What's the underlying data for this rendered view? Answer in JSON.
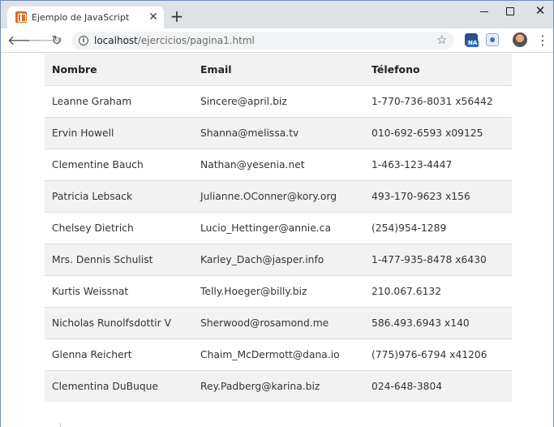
{
  "browser": {
    "tab_title": "Ejemplo de JavaScript",
    "tab_close": "✕",
    "new_tab": "+",
    "url_host": "localhost",
    "url_path": "/ejercicios/pagina1.html",
    "extension_badge": "NA",
    "icons": {
      "favicon": "xampp-icon",
      "back": "arrow-left-icon",
      "forward": "arrow-right-icon",
      "reload": "reload-icon",
      "info": "info-icon",
      "bookmark": "star-icon",
      "menu": "more-vertical-icon"
    }
  },
  "table": {
    "headers": [
      "Nombre",
      "Email",
      "Télefono"
    ],
    "rows": [
      [
        "Leanne Graham",
        "Sincere@april.biz",
        "1-770-736-8031 x56442"
      ],
      [
        "Ervin Howell",
        "Shanna@melissa.tv",
        "010-692-6593 x09125"
      ],
      [
        "Clementine Bauch",
        "Nathan@yesenia.net",
        "1-463-123-4447"
      ],
      [
        "Patricia Lebsack",
        "Julianne.OConner@kory.org",
        "493-170-9623 x156"
      ],
      [
        "Chelsey Dietrich",
        "Lucio_Hettinger@annie.ca",
        "(254)954-1289"
      ],
      [
        "Mrs. Dennis Schulist",
        "Karley_Dach@jasper.info",
        "1-477-935-8478 x6430"
      ],
      [
        "Kurtis Weissnat",
        "Telly.Hoeger@billy.biz",
        "210.067.6132"
      ],
      [
        "Nicholas Runolfsdottir V",
        "Sherwood@rosamond.me",
        "586.493.6943 x140"
      ],
      [
        "Glenna Reichert",
        "Chaim_McDermott@dana.io",
        "(775)976-6794 x41206"
      ],
      [
        "Clementina DuBuque",
        "Rey.Padberg@karina.biz",
        "024-648-3804"
      ]
    ]
  }
}
